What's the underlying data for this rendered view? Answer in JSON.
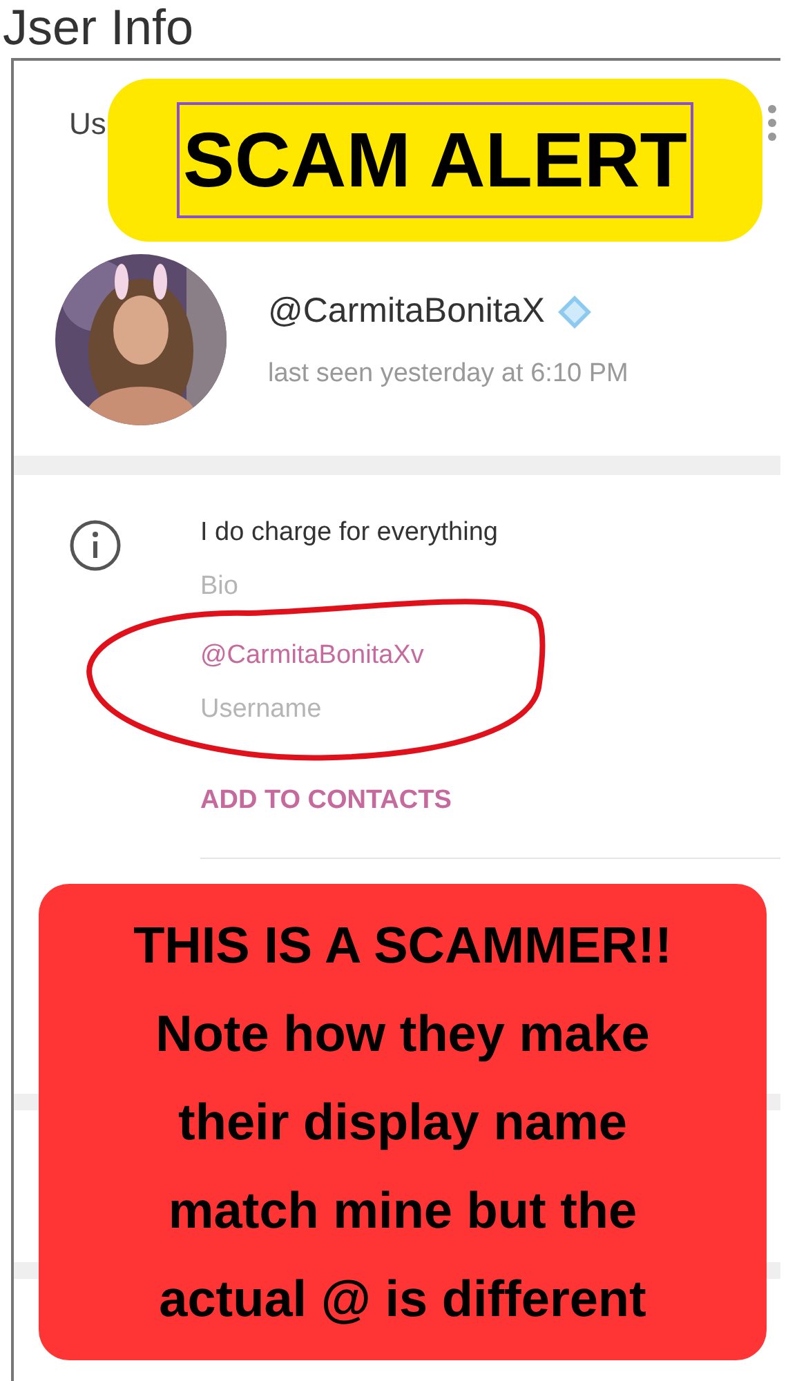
{
  "window": {
    "title": "Jser Info"
  },
  "header": {
    "title": "Us"
  },
  "profile": {
    "name": "@CarmitaBonitaX",
    "verified": true,
    "status": "last seen yesterday at 6:10 PM"
  },
  "info": [
    {
      "value": "I do charge for everything",
      "label": "Bio",
      "kind": "text"
    },
    {
      "value": "@CarmitaBonitaXv",
      "label": "Username",
      "kind": "link"
    }
  ],
  "action": "ADD TO CONTACTS",
  "annotations": {
    "alert": "SCAM ALERT",
    "note": [
      "THIS IS A SCAMMER!!",
      "Note how they make",
      "their display name",
      "match mine but the",
      "actual @ is different"
    ]
  }
}
